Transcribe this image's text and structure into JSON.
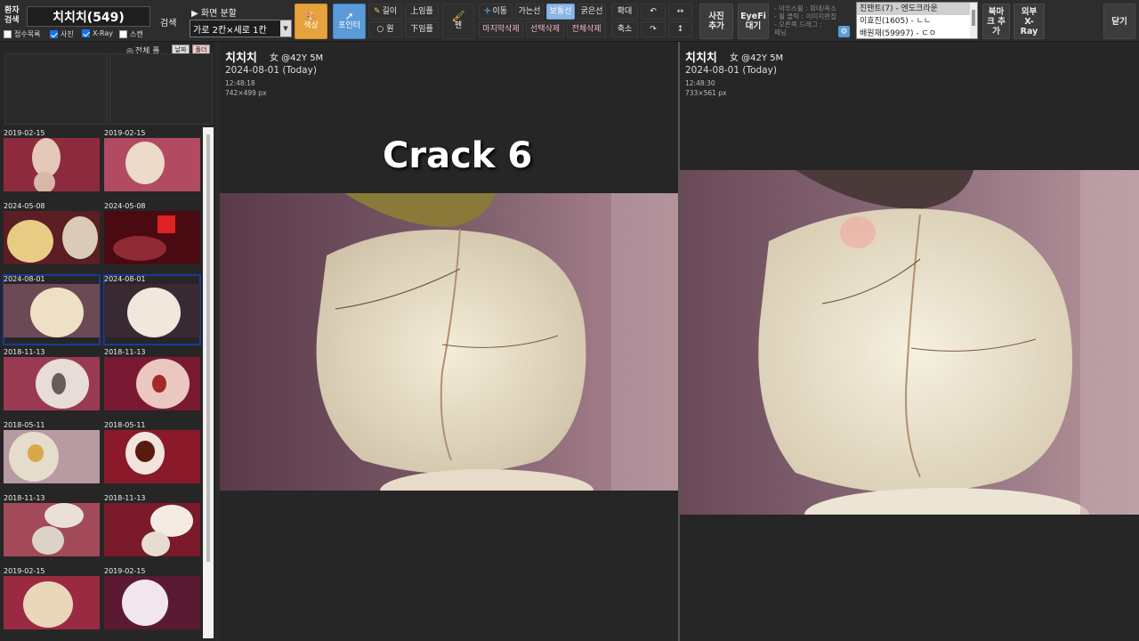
{
  "toolbar": {
    "patient_label": "환자 검색",
    "patient_name": "치치치(549)",
    "search_label": "검색",
    "checkboxes": [
      {
        "label": "접수목록",
        "checked": false
      },
      {
        "label": "사진",
        "checked": true
      },
      {
        "label": "X-Ray",
        "checked": true
      },
      {
        "label": "스캔",
        "checked": false
      }
    ],
    "split_title": "▶ 화면 분할",
    "split_value": "가로 2칸×세로 1칸",
    "color_btn": "색상",
    "pointer_btn": "포인터",
    "length_btn": "길이",
    "circle_btn": "원",
    "top_impression": "上임플",
    "bottom_impression": "下임플",
    "pen_btn": "펜",
    "move_btn": "이동",
    "thin_line_btn": "가는선",
    "normal_line_btn": "보통선",
    "thick_line_btn": "굵은선",
    "delete_last_btn": "마지막삭제",
    "delete_selected_btn": "선택삭제",
    "delete_all_btn": "전체삭제",
    "zoom_in_btn": "확대",
    "zoom_out_btn": "축소",
    "add_photo_btn": "사진 추가",
    "eyefi_btn": "EyeFi 대기",
    "hints": [
      "- 마우스휠 : 확대/축소",
      "- 휠 클릭 : 이미지편집",
      "- 오른쪽 드래그 :",
      "  패닝"
    ],
    "bookmarks": [
      "진맨트(7) - 엔도크라운",
      "이효진(1605) - ㄴㄴ",
      "배원재(59997) - ㄷㅇ"
    ],
    "add_bookmark_btn": "북마크 추가",
    "external_xray_btn": "외부 X-Ray",
    "close_btn": "닫기"
  },
  "left_panel": {
    "all_label": "전체 폴",
    "sort_date": "날짜",
    "sort_folder": "폴더",
    "thumbnails": [
      {
        "date": "2019-02-15",
        "selected": false
      },
      {
        "date": "2019-02-15",
        "selected": false
      },
      {
        "date": "2024-05-08",
        "selected": false
      },
      {
        "date": "2024-05-08",
        "selected": false
      },
      {
        "date": "2024-08-01",
        "selected": true
      },
      {
        "date": "2024-08-01",
        "selected": true
      },
      {
        "date": "2018-11-13",
        "selected": false
      },
      {
        "date": "2018-11-13",
        "selected": false
      },
      {
        "date": "2018-05-11",
        "selected": false
      },
      {
        "date": "2018-05-11",
        "selected": false
      },
      {
        "date": "2018-11-13",
        "selected": false
      },
      {
        "date": "2018-11-13",
        "selected": false
      },
      {
        "date": "2019-02-15",
        "selected": false
      },
      {
        "date": "2019-02-15",
        "selected": false
      }
    ]
  },
  "viewer_left": {
    "name": "치치치",
    "age": "女 @42Y 5M",
    "date": "2024-08-01 (Today)",
    "time": "12:48:18",
    "size": "742×499 px"
  },
  "viewer_right": {
    "name": "치치치",
    "age": "女 @42Y 5M",
    "date": "2024-08-01 (Today)",
    "time": "12:48:30",
    "size": "733×561 px"
  },
  "overlay_title": "Crack 6"
}
